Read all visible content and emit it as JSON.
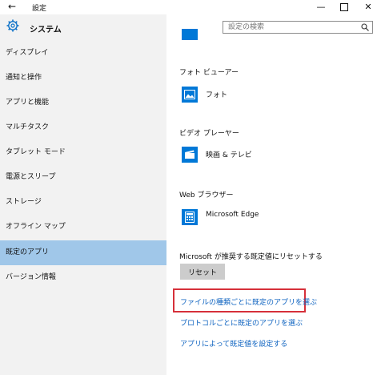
{
  "window": {
    "title": "設定",
    "back_icon": "←",
    "min_icon": "—",
    "close_icon": "✕"
  },
  "header": {
    "title": "システム",
    "search_placeholder": "設定の検索"
  },
  "sidebar": {
    "items": [
      {
        "label": "ディスプレイ"
      },
      {
        "label": "通知と操作"
      },
      {
        "label": "アプリと機能"
      },
      {
        "label": "マルチタスク"
      },
      {
        "label": "タブレット モード"
      },
      {
        "label": "電源とスリープ"
      },
      {
        "label": "ストレージ"
      },
      {
        "label": "オフライン マップ"
      },
      {
        "label": "既定のアプリ",
        "selected": true
      },
      {
        "label": "バージョン情報"
      }
    ]
  },
  "main": {
    "photo": {
      "heading": "フォト ビューアー",
      "app": "フォト"
    },
    "video": {
      "heading": "ビデオ プレーヤー",
      "app": "映画 & テレビ"
    },
    "browser": {
      "heading": "Web ブラウザー",
      "app": "Microsoft Edge"
    },
    "reset": {
      "label": "Microsoft が推奨する既定値にリセットする",
      "button": "リセット"
    },
    "links": [
      "ファイルの種類ごとに既定のアプリを選ぶ",
      "プロトコルごとに既定のアプリを選ぶ",
      "アプリによって既定値を設定する"
    ]
  },
  "colors": {
    "accent": "#0078d7",
    "selected_bg": "#a0c7e9",
    "sidebar_bg": "#f2f2f2",
    "link": "#0e63c0",
    "highlight_border": "#d6303a"
  }
}
